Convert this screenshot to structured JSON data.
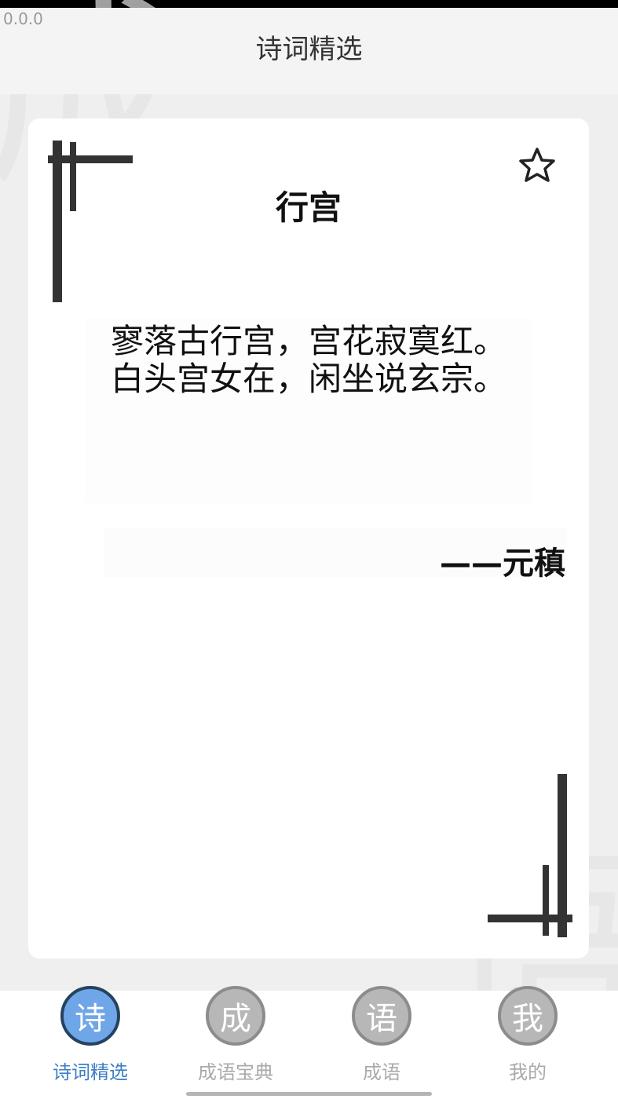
{
  "app": {
    "version": "0.0.0",
    "header_title": "诗词精选"
  },
  "poem": {
    "title": "行宫",
    "lines": [
      "寥落古行宫，宫花寂寞红。",
      "白头宫女在，闲坐说玄宗。"
    ],
    "author": "——元稹",
    "favorite_icon": "star-outline-icon"
  },
  "tabs": [
    {
      "label": "诗词精选",
      "icon_char": "诗",
      "active": true
    },
    {
      "label": "成语宝典",
      "icon_char": "成",
      "active": false
    },
    {
      "label": "成语",
      "icon_char": "语",
      "active": false
    },
    {
      "label": "我的",
      "icon_char": "我",
      "active": false
    }
  ],
  "colors": {
    "active_tab": "#3d7fc4",
    "inactive_tab": "#aaaaaa",
    "frame_bars": "#333333"
  }
}
